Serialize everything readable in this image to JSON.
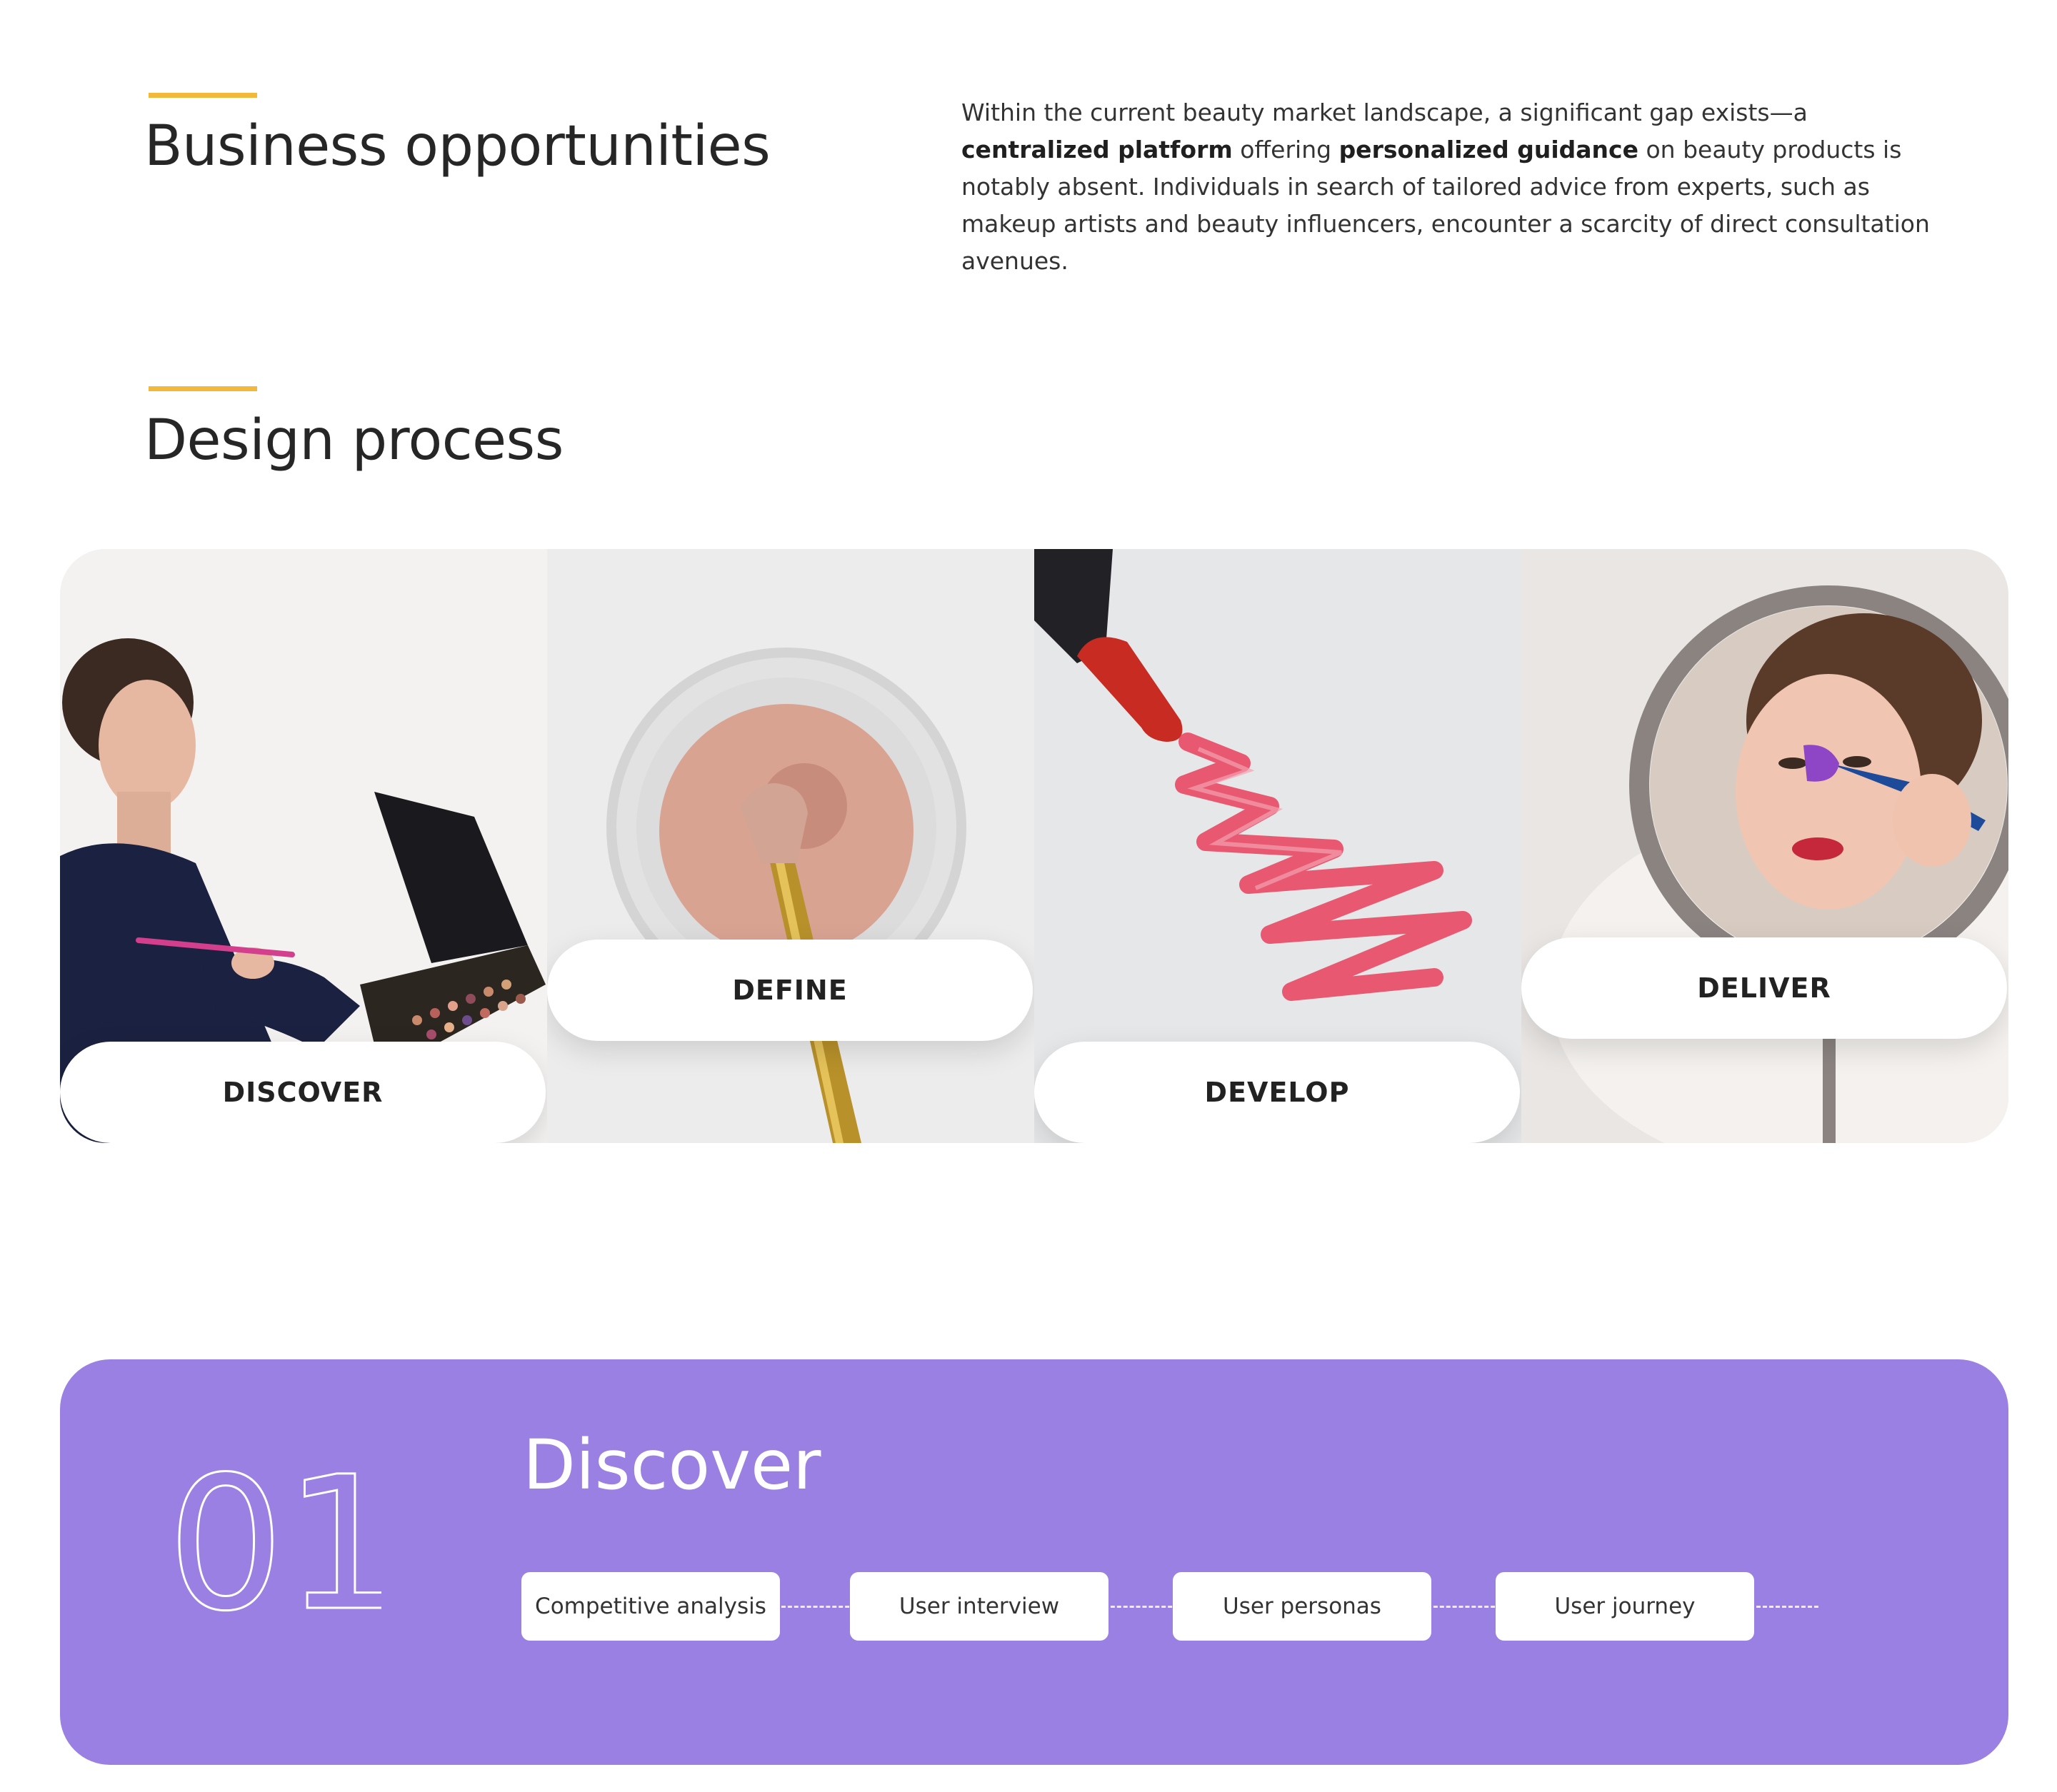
{
  "business": {
    "heading": "Business opportunities",
    "text_1": "Within the current beauty market landscape, a significant gap exists—a ",
    "bold_1": "centralized platform",
    "text_2": " offering ",
    "bold_2": "personalized guidance",
    "text_3": " on beauty products is notably absent. Individuals in search of tailored advice from experts, such as makeup artists and beauty influencers, encounter a scarcity of direct consultation avenues."
  },
  "design_process": {
    "heading": "Design process",
    "phases": [
      "DISCOVER",
      "DEFINE",
      "DEVELOP",
      "DELIVER"
    ]
  },
  "discover_section": {
    "number": "01",
    "title": "Discover",
    "steps": [
      "Competitive analysis",
      "User interview",
      "User personas",
      "User journey"
    ]
  },
  "colors": {
    "accent": "#f2b83a",
    "card_background": "#9a80e2",
    "text": "#262626"
  }
}
